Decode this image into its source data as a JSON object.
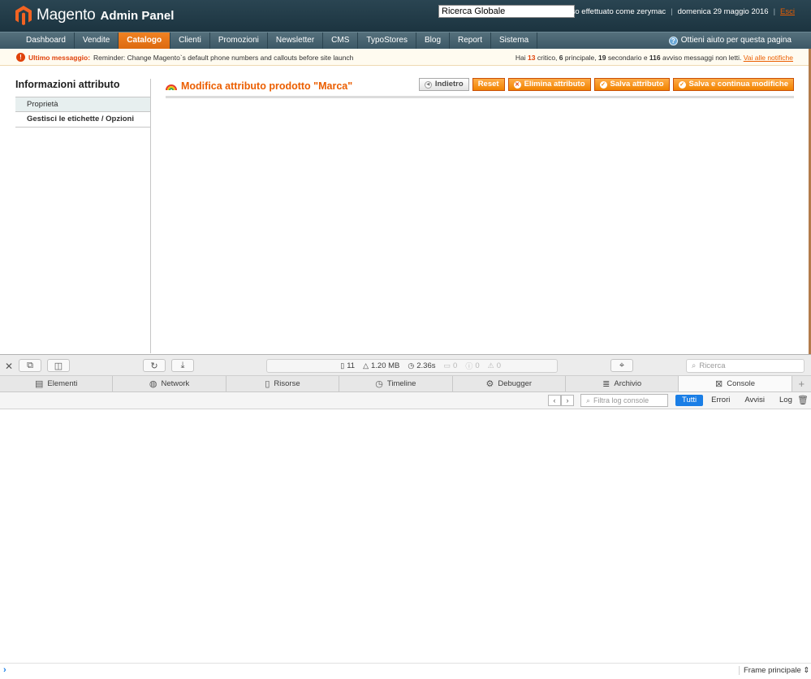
{
  "header": {
    "logo_text": "Magento",
    "logo_sub": "Admin Panel",
    "global_search_value": "Ricerca Globale",
    "logged_in": "Accesso effettuato come zerymac",
    "date": "domenica 29 maggio 2016",
    "separator": "|",
    "logout": "Esci"
  },
  "nav": {
    "items": [
      {
        "label": "Dashboard"
      },
      {
        "label": "Vendite"
      },
      {
        "label": "Catalogo"
      },
      {
        "label": "Clienti"
      },
      {
        "label": "Promozioni"
      },
      {
        "label": "Newsletter"
      },
      {
        "label": "CMS"
      },
      {
        "label": "TypoStores"
      },
      {
        "label": "Blog"
      },
      {
        "label": "Report"
      },
      {
        "label": "Sistema"
      }
    ],
    "active": "Catalogo",
    "help": "Ottieni aiuto per questa pagina"
  },
  "messages": {
    "label": "Ultimo messaggio:",
    "text": "Reminder: Change Magento`s default phone numbers and callouts before site launch",
    "summary_prefix": "Hai",
    "critical_count": "13",
    "critical_label": "critico,",
    "major_count": "6",
    "major_label": "principale,",
    "minor_count": "19",
    "minor_label": "secondario e",
    "notice_count": "116",
    "notice_label": "avviso messaggi non letti.",
    "link": "Vai alle notifiche"
  },
  "sidebar": {
    "title": "Informazioni attributo",
    "tabs": [
      {
        "label": "Proprietà"
      },
      {
        "label": "Gestisci le etichette / Opzioni"
      }
    ]
  },
  "content": {
    "title": "Modifica attributo prodotto \"Marca\"",
    "buttons": {
      "back": "Indietro",
      "reset": "Reset",
      "delete": "Elimina attributo",
      "save": "Salva attributo",
      "save_continue": "Salva e continua modifiche"
    }
  },
  "inspector": {
    "resources_count": "11",
    "size": "1.20 MB",
    "time": "2.36s",
    "logs": "0",
    "errors": "0",
    "warnings": "0",
    "search_placeholder": "Ricerca",
    "tabs": [
      {
        "label": "Elementi",
        "icon": "elements-icon"
      },
      {
        "label": "Network",
        "icon": "network-icon"
      },
      {
        "label": "Risorse",
        "icon": "resources-icon"
      },
      {
        "label": "Timeline",
        "icon": "timeline-icon"
      },
      {
        "label": "Debugger",
        "icon": "debugger-icon"
      },
      {
        "label": "Archivio",
        "icon": "storage-icon"
      },
      {
        "label": "Console",
        "icon": "console-icon"
      }
    ],
    "active_tab": "Console",
    "console_filter_placeholder": "Filtra log console",
    "levels": [
      {
        "label": "Tutti"
      },
      {
        "label": "Errori"
      },
      {
        "label": "Avvisi"
      },
      {
        "label": "Log"
      }
    ],
    "active_level": "Tutti",
    "frame": "Frame principale"
  },
  "colors": {
    "accent": "#eb5e00",
    "header_bg": "#1c3440",
    "nav_bg": "#4a6571",
    "console_active": "#1a7ee6"
  }
}
